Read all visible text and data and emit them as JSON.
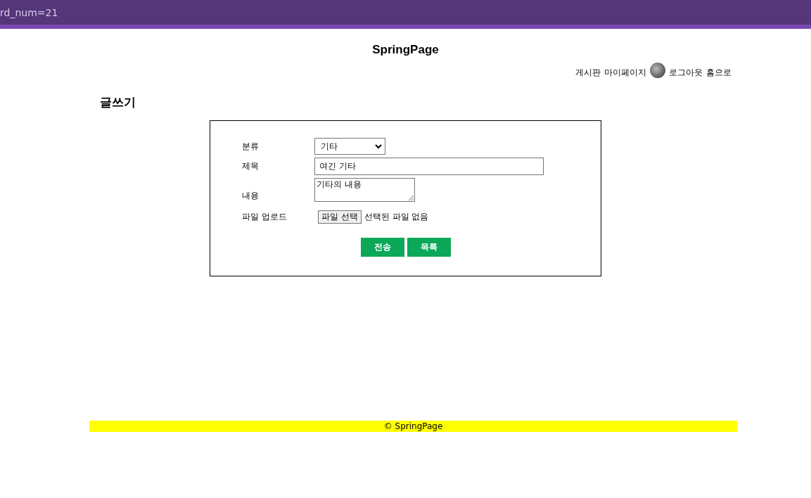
{
  "top_bar": {
    "text": "rd_num=21"
  },
  "site_title": "SpringPage",
  "nav": {
    "links": [
      {
        "label": "게시판"
      },
      {
        "label": "마이페이지"
      }
    ],
    "after_links": [
      {
        "label": "로그아웃"
      },
      {
        "label": "홈으로"
      }
    ]
  },
  "heading": "글쓰기",
  "form": {
    "fields": [
      {
        "kind": "select",
        "label": "분류",
        "value": "기타"
      },
      {
        "kind": "text",
        "label": "제목",
        "value": "여긴 기타"
      },
      {
        "kind": "textarea",
        "label": "내용",
        "value": "기타의 내용"
      },
      {
        "kind": "file",
        "label": "파일 업로드",
        "button": "파일 선택",
        "status": "선택된 파일 없음"
      }
    ],
    "buttons": [
      "전송",
      "목록"
    ]
  },
  "footer": "© SpringPage"
}
